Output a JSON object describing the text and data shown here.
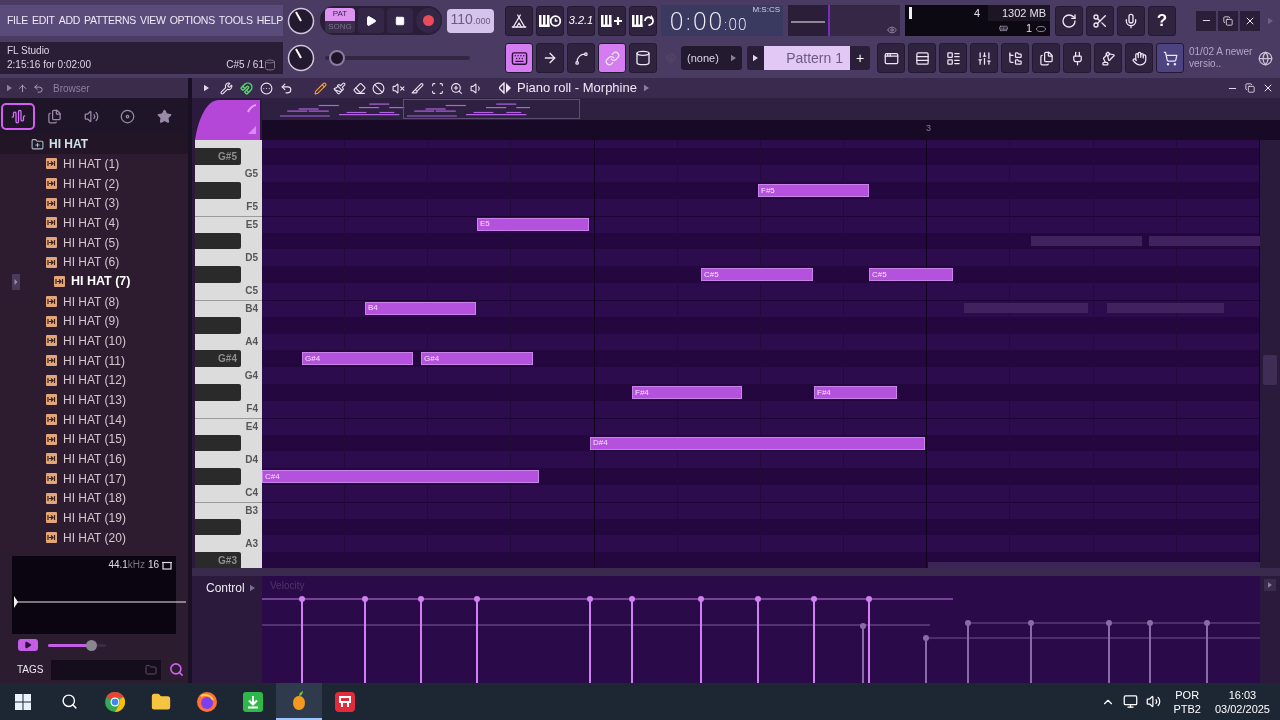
{
  "menu": [
    "FILE",
    "EDIT",
    "ADD",
    "PATTERNS",
    "VIEW",
    "OPTIONS",
    "TOOLS",
    "HELP"
  ],
  "hint_panel": {
    "title": "FL Studio",
    "message": "2:15:16 for 0:02:00",
    "note": "C#5 / 61"
  },
  "transport": {
    "modes": [
      {
        "label": "PAT",
        "selected": true
      },
      {
        "label": "SONG",
        "selected": false
      }
    ],
    "tempo": {
      "whole": "110",
      "fraction": ".000"
    }
  },
  "countdown_label": "3.2.1",
  "time_display": {
    "main": "0:00",
    "small": ":00",
    "unit": "M:S:CS"
  },
  "monitor": {
    "polyphony": "4",
    "memory": "1302 MB",
    "value_3": "1"
  },
  "help_label": "?",
  "master_pitch": {
    "level": 0.03
  },
  "tool_toggles": [
    {
      "on": true
    },
    {
      "on": false
    },
    {
      "on": false
    },
    {
      "on": true
    },
    {
      "on": false
    }
  ],
  "snap": {
    "value": "(none)"
  },
  "pattern": {
    "name": "Pattern 1",
    "add_label": "+"
  },
  "news": {
    "date": "01/02",
    "message": "A newer versio.."
  },
  "browser": {
    "title": "Browser",
    "tabs": [
      {
        "selected": true
      },
      {
        "selected": false
      },
      {
        "selected": false
      },
      {
        "selected": false
      },
      {
        "selected": false
      }
    ],
    "tree": [
      {
        "label": "HI HAT",
        "expanded": true,
        "children": [
          {
            "label": "HI HAT (1)",
            "selected": false
          },
          {
            "label": "HI HAT (2)",
            "selected": false
          },
          {
            "label": "HI HAT (3)",
            "selected": false
          },
          {
            "label": "HI HAT (4)",
            "selected": false
          },
          {
            "label": "HI HAT (5)",
            "selected": false
          },
          {
            "label": "HI HAT (6)",
            "selected": false
          },
          {
            "label": "HI HAT (7)",
            "selected": true
          },
          {
            "label": "HI HAT (8)",
            "selected": false
          },
          {
            "label": "HI HAT (9)",
            "selected": false
          },
          {
            "label": "HI HAT (10)",
            "selected": false
          },
          {
            "label": "HI HAT (11)",
            "selected": false
          },
          {
            "label": "HI HAT (12)",
            "selected": false
          },
          {
            "label": "HI HAT (13)",
            "selected": false
          },
          {
            "label": "HI HAT (14)",
            "selected": false
          },
          {
            "label": "HI HAT (15)",
            "selected": false
          },
          {
            "label": "HI HAT (16)",
            "selected": false
          },
          {
            "label": "HI HAT (17)",
            "selected": false
          },
          {
            "label": "HI HAT (18)",
            "selected": false
          },
          {
            "label": "HI HAT (19)",
            "selected": false
          },
          {
            "label": "HI HAT (20)",
            "selected": false
          }
        ]
      }
    ],
    "sample_info": {
      "rate": "44.1",
      "unit": "kHz",
      "bits": "16"
    },
    "preview_volume": {
      "level": 0.8
    },
    "tags_label": "TAGS"
  },
  "piano_roll": {
    "title": "Piano roll - Morphine",
    "snap_on": true,
    "tools": [
      {
        "selected": true
      },
      {
        "selected": false
      },
      {
        "selected": false
      },
      {
        "selected": false
      },
      {
        "selected": false
      },
      {
        "selected": false
      },
      {
        "selected": false
      },
      {
        "selected": false
      },
      {
        "selected": false
      }
    ],
    "ruler": "3",
    "keys": [
      "G#5",
      "G5",
      "F5",
      "E5",
      "D5",
      "C5",
      "B4",
      "A4",
      "G#4",
      "G4",
      "F4",
      "E4",
      "D4",
      "C4",
      "B3",
      "A3",
      "G#3"
    ],
    "notes": [
      {
        "label": "F#5"
      },
      {
        "label": "E5"
      },
      {
        "label": "C#5"
      },
      {
        "label": "C#5"
      },
      {
        "label": "B4"
      },
      {
        "label": "G#4"
      },
      {
        "label": "G#4"
      },
      {
        "label": "F#4"
      },
      {
        "label": "F#4"
      },
      {
        "label": "D#4"
      },
      {
        "label": "C#4"
      }
    ],
    "control": {
      "label": "Control",
      "parameter": "Velocity"
    }
  },
  "taskbar": {
    "apps": [
      {
        "selected": false
      },
      {
        "selected": false
      },
      {
        "selected": false
      },
      {
        "selected": false
      },
      {
        "selected": true
      },
      {
        "selected": false
      }
    ],
    "language": "POR",
    "layout": "PTB2",
    "time": "16:03",
    "date": "03/02/2025"
  }
}
